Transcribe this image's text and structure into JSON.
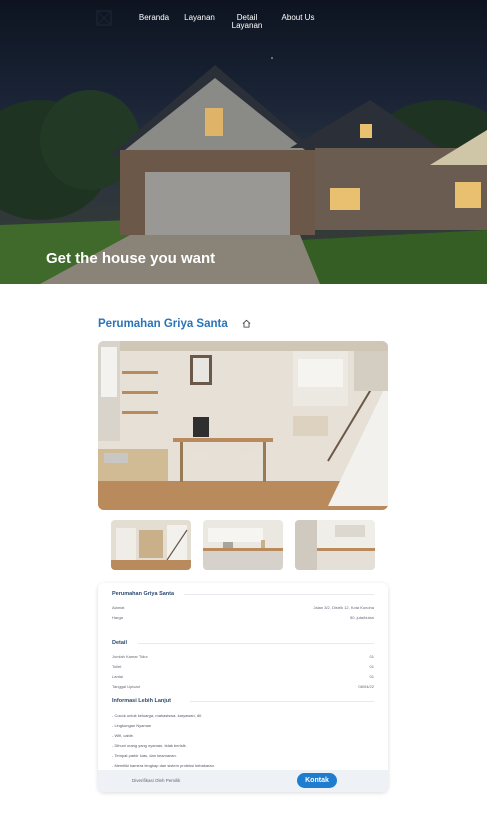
{
  "nav": {
    "items": [
      {
        "label": "Beranda"
      },
      {
        "label": "Layanan"
      },
      {
        "label": "Detail Layanan"
      },
      {
        "label": "About Us"
      }
    ]
  },
  "hero": {
    "title": "Get the house you want"
  },
  "property": {
    "name": "Perumahan Griya Santa",
    "home_icon": "home-icon"
  },
  "card": {
    "title": "Perumahan Griya Santa",
    "address_label": "Alamat",
    "address_value": "Jalan 3/2, Distrik 12, Kota Konoha",
    "price_label": "Harga",
    "price_value": "50. juta/bulan",
    "detail_heading": "Detail",
    "details": [
      {
        "label": "Jumlah Kamar Tidur",
        "value": "01"
      },
      {
        "label": "Toilet",
        "value": "01"
      },
      {
        "label": "Lantai",
        "value": "01"
      },
      {
        "label": "Tanggal Upload",
        "value": "08/04/22"
      }
    ],
    "info_heading": "Informasi Lebih Lanjut",
    "info_items": [
      "- Cocok untuk keluarga, mahasiswa, karyawan, dll.",
      "- Lingkungan Nyaman",
      "- Wifi, cable.",
      "- Dihuni orang yang nyaman, tidak berisik.",
      "- Tempat parkir luas, dan keamanan.",
      "- Memiliki kamera lengkap dan sistem proteksi kebakaran."
    ],
    "verified": "Diverifikasi Oleh Pemilik",
    "contact_label": "Kontak"
  },
  "colors": {
    "accent": "#2a73b8",
    "button": "#1f7dd0"
  }
}
